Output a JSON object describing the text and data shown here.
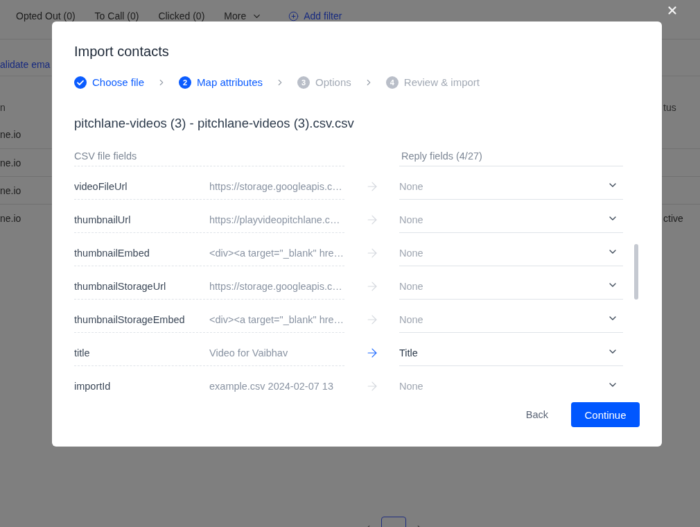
{
  "background": {
    "filter_tabs": [
      {
        "label": "Opted Out (0)"
      },
      {
        "label": "To Call (0)"
      },
      {
        "label": "Clicked (0)"
      }
    ],
    "more_menu": {
      "label": "More"
    },
    "add_filter": {
      "label": "Add filter"
    },
    "validate_button": {
      "label": "alidate ema"
    },
    "table": {
      "columns": [
        "n",
        "tus"
      ],
      "rows": [
        {
          "cells": [
            "ne.io"
          ]
        },
        {
          "cells": [
            "ne.io"
          ]
        },
        {
          "cells": [
            "ne.io"
          ]
        },
        {
          "cells": [
            "ne.io",
            "ctive"
          ]
        }
      ]
    },
    "pagination": {
      "pages": [
        {
          "selected": true
        }
      ]
    }
  },
  "modal": {
    "title": "Import contacts",
    "steps": [
      {
        "label": "Choose file",
        "completed": true,
        "selected": false
      },
      {
        "number": "2",
        "label": "Map attributes",
        "completed": false,
        "selected": true
      },
      {
        "number": "3",
        "label": "Options",
        "completed": false,
        "selected": false
      },
      {
        "number": "4",
        "label": "Review & import",
        "completed": false,
        "selected": false
      }
    ],
    "file_name": "pitchlane-videos (3) - pitchlane-videos (3).csv.csv",
    "csv_header": "CSV file fields",
    "reply_header": "Reply fields (4/27)",
    "mappings": [
      {
        "field": "videoFileUrl",
        "sample": "https://storage.googleapis.c…",
        "target": "None",
        "mapped": false
      },
      {
        "field": "thumbnailUrl",
        "sample": "https://playvideopitchlane.c…",
        "target": "None",
        "mapped": false
      },
      {
        "field": "thumbnailEmbed",
        "sample": "<div><a target=\"_blank\" hre…",
        "target": "None",
        "mapped": false
      },
      {
        "field": "thumbnailStorageUrl",
        "sample": "https://storage.googleapis.c…",
        "target": "None",
        "mapped": false
      },
      {
        "field": "thumbnailStorageEmbed",
        "sample": "<div><a target=\"_blank\" hre…",
        "target": "None",
        "mapped": false
      },
      {
        "field": "title",
        "sample": "Video for Vaibhav",
        "target": "Title",
        "mapped": true
      },
      {
        "field": "importId",
        "sample": "example.csv 2024-02-07 13",
        "target": "None",
        "mapped": false
      }
    ],
    "back_button": "Back",
    "continue_button": "Continue"
  }
}
